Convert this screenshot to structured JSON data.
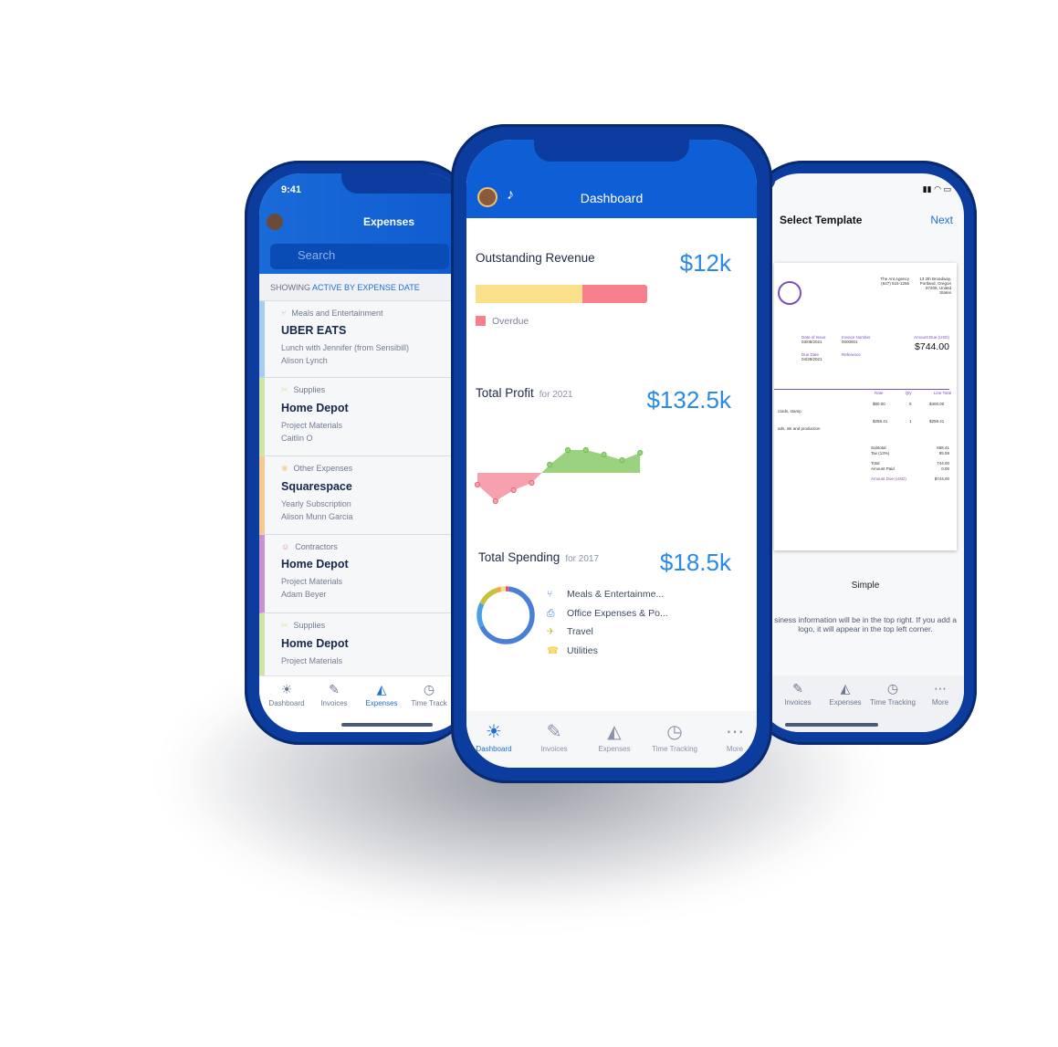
{
  "colors": {
    "brand_blue": "#0e5fd6",
    "accent": "#2a8ae8",
    "profit": "#9ad27f",
    "loss": "#f6a1ae",
    "revenue_current": "#fbe08a",
    "revenue_overdue": "#f77f8e"
  },
  "left_phone": {
    "status_time": "9:41",
    "title": "Expenses",
    "search_placeholder": "Search",
    "filter": {
      "prefix": "SHOWING",
      "value": "ACTIVE BY EXPENSE DATE"
    },
    "expenses": [
      {
        "category": "Meals and Entertainment",
        "icon": "fork-knife-icon",
        "name": "UBER EATS",
        "description": "Lunch with Jennifer (from Sensibill)",
        "person": "Alison Lynch",
        "color": "#a7cdf2"
      },
      {
        "category": "Supplies",
        "icon": "tools-icon",
        "name": "Home Depot",
        "description": "Project Materials",
        "person": "Caitlin O",
        "color": "#cfe6a3"
      },
      {
        "category": "Other Expenses",
        "icon": "boxes-icon",
        "name": "Squarespace",
        "description": "Yearly Subscription",
        "person": "Alison Munn Garcia",
        "color": "#f8c98f"
      },
      {
        "category": "Contractors",
        "icon": "people-icon",
        "name": "Home Depot",
        "description": "Project Materials",
        "person": "Adam Beyer",
        "color": "#c993d1"
      },
      {
        "category": "Supplies",
        "icon": "tools-icon",
        "name": "Home Depot",
        "description": "Project Materials",
        "person": "",
        "color": "#cfe6a3"
      }
    ],
    "tabs": [
      {
        "label": "Dashboard",
        "icon": "sunrise-icon"
      },
      {
        "label": "Invoices",
        "icon": "invoice-icon"
      },
      {
        "label": "Expenses",
        "icon": "pizza-icon",
        "active": true
      },
      {
        "label": "Time Track",
        "icon": "stopwatch-icon"
      }
    ]
  },
  "center_phone": {
    "title": "Dashboard",
    "outstanding": {
      "title": "Outstanding Revenue",
      "amount": "$12k",
      "legend": "Overdue",
      "current_fraction": 0.62,
      "overdue_fraction": 0.38
    },
    "profit": {
      "title": "Total Profit",
      "period": "for 2021",
      "amount": "$132.5k"
    },
    "spending": {
      "title": "Total Spending",
      "period": "for 2017",
      "amount": "$18.5k",
      "legend": [
        {
          "label": "Meals & Entertainme...",
          "icon": "fork-knife-icon",
          "color": "#4a90e2"
        },
        {
          "label": "Office Expenses & Po...",
          "icon": "printer-icon",
          "color": "#3f7fd8"
        },
        {
          "label": "Travel",
          "icon": "plane-icon",
          "color": "#c7c23a"
        },
        {
          "label": "Utilities",
          "icon": "phone-icon",
          "color": "#f2cf4a"
        }
      ]
    },
    "tabs": [
      {
        "label": "Dashboard",
        "icon": "sunrise-icon",
        "active": true
      },
      {
        "label": "Invoices",
        "icon": "invoice-icon"
      },
      {
        "label": "Expenses",
        "icon": "pizza-icon"
      },
      {
        "label": "Time Tracking",
        "icon": "stopwatch-icon"
      },
      {
        "label": "More",
        "icon": "more-icon"
      }
    ]
  },
  "right_phone": {
    "title": "Select Template",
    "next": "Next",
    "template_name": "Simple",
    "template_description": "siness information will be in the top right. If you add a logo, it will appear in the top left corner.",
    "invoice": {
      "company": "The Ant Agency",
      "phone": "(647) 515-1256",
      "address": "13 2th Broadway, Portland, Oregon 97205, United States",
      "date_label": "Date of Issue",
      "date": "03/08/2021",
      "number_label": "Invoice Number",
      "number": "0000001",
      "due_label": "Due Date",
      "due": "04/28/2021",
      "reference_label": "Reference",
      "amount_due_label": "Amount Due (USD)",
      "amount_due": "$744.00",
      "columns": [
        "Rate",
        "Qty",
        "Line Total"
      ],
      "lines": [
        {
          "desc": "cards, stamp",
          "rate": "$80.00",
          "qty": "5",
          "total": "$400.00"
        },
        {
          "desc": "ads, ink and production",
          "rate": "$258.41",
          "qty": "1",
          "total": "$258.41"
        }
      ],
      "subtotal_label": "Subtotal",
      "subtotal": "658.41",
      "tax_label": "Tax (13%)",
      "tax": "85.59",
      "total_label": "Total",
      "total": "744.00",
      "paid_label": "Amount Paid",
      "paid": "0.00",
      "due_total_label": "Amount Due (USD)",
      "due_total": "$744.00"
    },
    "tabs": [
      {
        "label": "Invoices",
        "icon": "invoice-icon"
      },
      {
        "label": "Expenses",
        "icon": "pizza-icon"
      },
      {
        "label": "Time Tracking",
        "icon": "stopwatch-icon"
      },
      {
        "label": "More",
        "icon": "more-icon"
      }
    ]
  },
  "chart_data": [
    {
      "type": "area",
      "title": "Total Profit",
      "values": [
        -13,
        -31,
        -19,
        -11,
        9,
        25,
        25,
        20,
        14,
        22
      ]
    },
    {
      "type": "pie",
      "title": "Total Spending",
      "values": [
        2,
        66,
        14,
        12,
        3,
        3
      ],
      "colors": [
        "#d9577f",
        "#4a7fd6",
        "#4aa0e6",
        "#c7c23a",
        "#f0a94a",
        "#f6e08a"
      ]
    }
  ]
}
